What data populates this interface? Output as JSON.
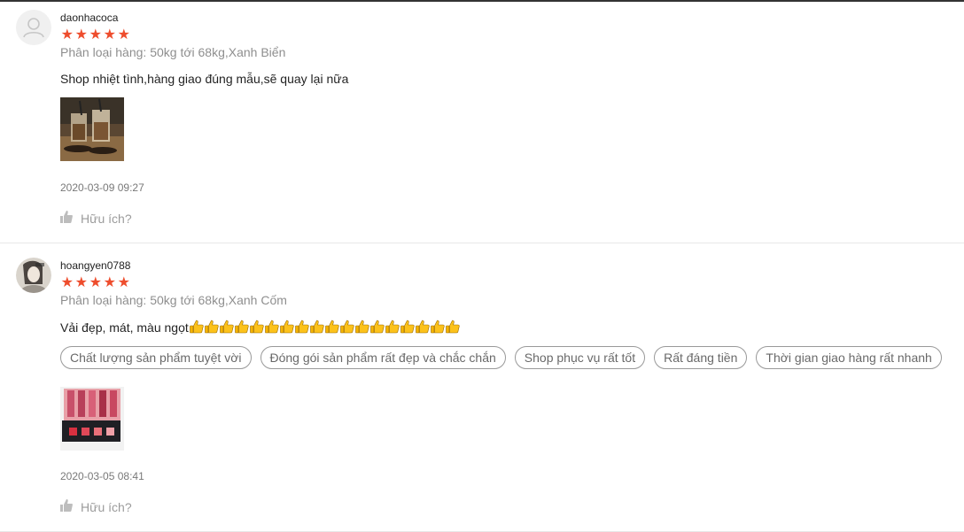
{
  "colors": {
    "star": "#ee4d2d",
    "tag_border": "#999999",
    "muted": "#a6a6a6"
  },
  "reviews": [
    {
      "username": "daonhacoca",
      "rating": 5,
      "stars": [
        "★",
        "★",
        "★",
        "★",
        "★"
      ],
      "variation": "Phân loại hàng: 50kg tới 68kg,Xanh Biển",
      "comment": "Shop nhiệt tình,hàng giao đúng mẫu,sẽ quay lại nữa",
      "timestamp": "2020-03-09 09:27",
      "helpful_label": "Hữu ích?",
      "icons": {
        "avatar": "default-user-icon",
        "helpful": "thumbs-up-icon"
      }
    },
    {
      "username": "hoangyen0788",
      "rating": 5,
      "stars": [
        "★",
        "★",
        "★",
        "★",
        "★"
      ],
      "variation": "Phân loại hàng: 50kg tới 68kg,Xanh Cốm",
      "comment": "Vải đẹp, mát, màu ngọt",
      "emoji_count": 18,
      "emoji": "thumbs-up-emoji",
      "tags": [
        "Chất lượng sản phẩm tuyệt vời",
        "Đóng gói sản phẩm rất đẹp và chắc chắn",
        "Shop phục vụ rất tốt",
        "Rất đáng tiền",
        "Thời gian giao hàng rất nhanh"
      ],
      "timestamp": "2020-03-05 08:41",
      "helpful_label": "Hữu ích?",
      "icons": {
        "avatar": "user-photo-avatar",
        "helpful": "thumbs-up-icon"
      }
    }
  ]
}
